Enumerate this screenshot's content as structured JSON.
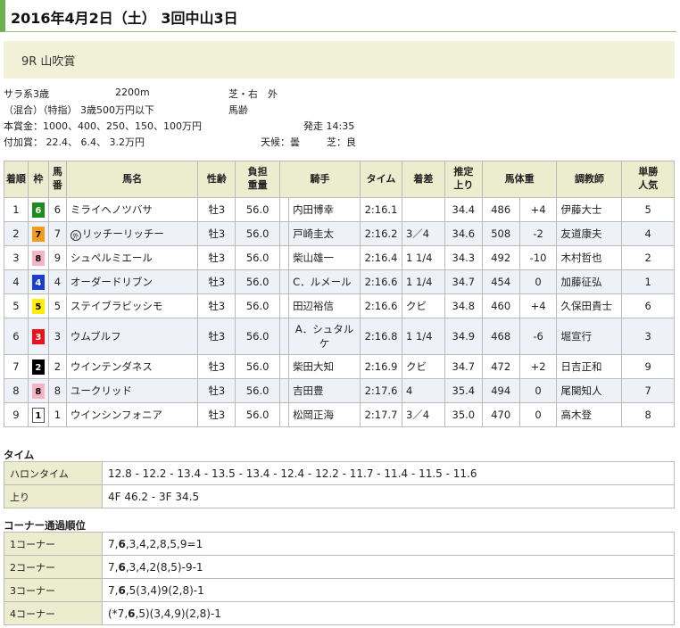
{
  "header": {
    "title": "2016年4月2日（土） 3回中山3日"
  },
  "race": {
    "name": "9R 山吹賞"
  },
  "info": {
    "class": "サラ系3歳",
    "distance": "2200m",
    "course": "芝・右　外",
    "conditions": "（混合）（特指）  3歳500万円以下",
    "weight_rule": "馬齢",
    "prize": "本賞金：1000、400、250、150、100万円",
    "start": "発走 14:35",
    "bonus": "付加賞： 22.4、 6.4、 3.2万円",
    "weather": "天候：曇",
    "going": "芝：良"
  },
  "results": {
    "headers": {
      "rank": "着順",
      "waku": "枠",
      "num": "馬番",
      "horse": "馬名",
      "sexage": "性齢",
      "weight": "負担重量",
      "jockey": "騎手",
      "time": "タイム",
      "margin": "着差",
      "last3f": "推定上り",
      "bodyweight": "馬体重",
      "trainer": "調教師",
      "pop": "単勝人気"
    },
    "rows": [
      {
        "rank": "1",
        "waku": "6",
        "num": "6",
        "horse": "ミライヘノツバサ",
        "mark": "",
        "sexage": "牡3",
        "weight": "56.0",
        "jockey": "内田博幸",
        "time": "2:16.1",
        "margin": "",
        "last3f": "34.4",
        "bw": "486",
        "bwd": "+4",
        "trainer": "伊藤大士",
        "pop": "5"
      },
      {
        "rank": "2",
        "waku": "7",
        "num": "7",
        "horse": "リッチーリッチー",
        "mark": "外",
        "sexage": "牡3",
        "weight": "56.0",
        "jockey": "戸崎圭太",
        "time": "2:16.2",
        "margin": "3／4",
        "last3f": "34.6",
        "bw": "508",
        "bwd": "-2",
        "trainer": "友道康夫",
        "pop": "4"
      },
      {
        "rank": "3",
        "waku": "8",
        "num": "9",
        "horse": "シュペルミエール",
        "mark": "",
        "sexage": "牡3",
        "weight": "56.0",
        "jockey": "柴山雄一",
        "time": "2:16.4",
        "margin": "1 1/4",
        "last3f": "34.3",
        "bw": "492",
        "bwd": "-10",
        "trainer": "木村哲也",
        "pop": "2"
      },
      {
        "rank": "4",
        "waku": "4",
        "num": "4",
        "horse": "オーダードリブン",
        "mark": "",
        "sexage": "牡3",
        "weight": "56.0",
        "jockey": "C．ルメール",
        "time": "2:16.6",
        "margin": "1 1/4",
        "last3f": "34.7",
        "bw": "454",
        "bwd": "0",
        "trainer": "加藤征弘",
        "pop": "1"
      },
      {
        "rank": "5",
        "waku": "5",
        "num": "5",
        "horse": "ステイブラビッシモ",
        "mark": "",
        "sexage": "牡3",
        "weight": "56.0",
        "jockey": "田辺裕信",
        "time": "2:16.6",
        "margin": "クビ",
        "last3f": "34.8",
        "bw": "460",
        "bwd": "+4",
        "trainer": "久保田貴士",
        "pop": "6"
      },
      {
        "rank": "6",
        "waku": "3",
        "num": "3",
        "horse": "ウムブルフ",
        "mark": "",
        "sexage": "牡3",
        "weight": "56.0",
        "jockey": "A．シュタルケ",
        "time": "2:16.8",
        "margin": "1 1/4",
        "last3f": "34.9",
        "bw": "468",
        "bwd": "-6",
        "trainer": "堀宣行",
        "pop": "3"
      },
      {
        "rank": "7",
        "waku": "2",
        "num": "2",
        "horse": "ウインテンダネス",
        "mark": "",
        "sexage": "牡3",
        "weight": "56.0",
        "jockey": "柴田大知",
        "time": "2:16.9",
        "margin": "クビ",
        "last3f": "34.7",
        "bw": "472",
        "bwd": "+2",
        "trainer": "日吉正和",
        "pop": "9"
      },
      {
        "rank": "8",
        "waku": "8",
        "num": "8",
        "horse": "ユークリッド",
        "mark": "",
        "sexage": "牡3",
        "weight": "56.0",
        "jockey": "吉田豊",
        "time": "2:17.6",
        "margin": "4",
        "last3f": "35.4",
        "bw": "494",
        "bwd": "0",
        "trainer": "尾関知人",
        "pop": "7"
      },
      {
        "rank": "9",
        "waku": "1",
        "num": "1",
        "horse": "ウインシンフォニア",
        "mark": "",
        "sexage": "牡3",
        "weight": "56.0",
        "jockey": "松岡正海",
        "time": "2:17.7",
        "margin": "3／4",
        "last3f": "35.0",
        "bw": "470",
        "bwd": "0",
        "trainer": "高木登",
        "pop": "8"
      }
    ]
  },
  "waku_colors": {
    "1": {
      "bg": "#ffffff",
      "fg": "#000000"
    },
    "2": {
      "bg": "#000000",
      "fg": "#ffffff"
    },
    "3": {
      "bg": "#e8141b",
      "fg": "#ffffff"
    },
    "4": {
      "bg": "#1a3fcf",
      "fg": "#ffffff"
    },
    "5": {
      "bg": "#ffee00",
      "fg": "#000000"
    },
    "6": {
      "bg": "#1f8a1f",
      "fg": "#ffffff"
    },
    "7": {
      "bg": "#f39b1e",
      "fg": "#000000"
    },
    "8": {
      "bg": "#f6b3c4",
      "fg": "#000000"
    }
  },
  "time": {
    "title": "タイム",
    "rows": [
      {
        "label": "ハロンタイム",
        "value": "12.8 - 12.2 - 13.4 - 13.5 - 13.4 - 12.4 - 12.2 - 11.7 - 11.4 - 11.5 - 11.6"
      },
      {
        "label": "上り",
        "value": "4F 46.2 - 3F 34.5"
      }
    ]
  },
  "corners": {
    "title": "コーナー通過順位",
    "rows": [
      {
        "label": "1コーナー",
        "pre": "7,",
        "bold": "6",
        "post": ",3,4,2,8,5,9=1"
      },
      {
        "label": "2コーナー",
        "pre": "7,",
        "bold": "6",
        "post": ",3,4,2(8,5)-9-1"
      },
      {
        "label": "3コーナー",
        "pre": "7,",
        "bold": "6",
        "post": ",5(3,4)9(2,8)-1"
      },
      {
        "label": "4コーナー",
        "pre": "(*7,",
        "bold": "6",
        "post": ",5)(3,4,9)(2,8)-1"
      }
    ]
  }
}
